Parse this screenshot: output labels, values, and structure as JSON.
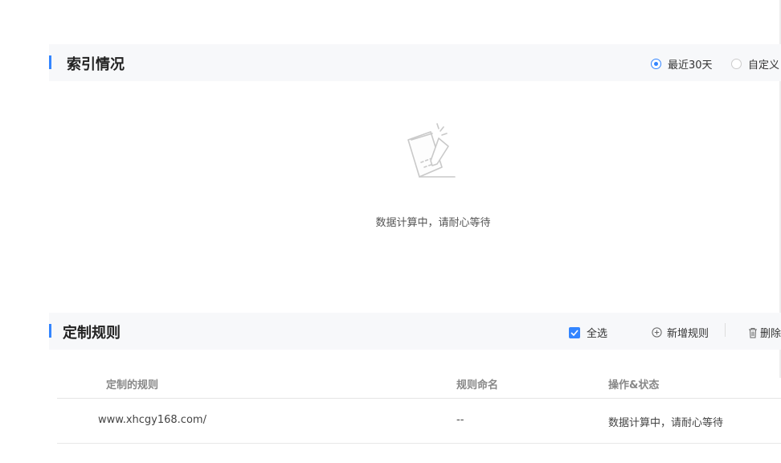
{
  "index_section": {
    "title": "索引情况",
    "range_options": [
      "最近30天",
      "自定义"
    ],
    "selected_range": "最近30天",
    "empty_message": "数据计算中，请耐心等待"
  },
  "rules_section": {
    "title": "定制规则",
    "select_all_label": "全选",
    "select_all_checked": true,
    "add_rule_label": "新增规则",
    "delete_label": "删除",
    "columns": [
      "定制的规则",
      "规则命名",
      "操作&状态"
    ],
    "rows": [
      {
        "rule": "www.xhcgy168.com/",
        "name": "--",
        "status": "数据计算中，请耐心等待"
      }
    ]
  },
  "colors": {
    "accent": "#3385ff",
    "header_bg": "#f7f8fa"
  }
}
